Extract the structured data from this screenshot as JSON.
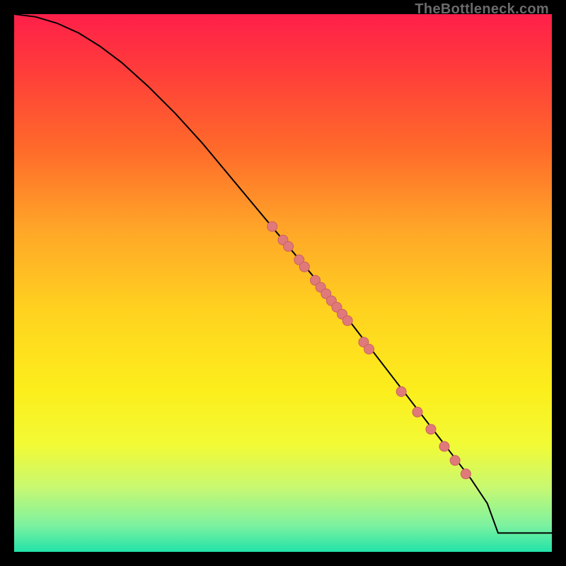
{
  "watermark": "TheBottleneck.com",
  "colors": {
    "line": "#000000",
    "dot_fill": "#e07a7a",
    "dot_stroke": "#c96060"
  },
  "chart_data": {
    "type": "line",
    "title": "",
    "xlabel": "",
    "ylabel": "",
    "xlim": [
      0,
      100
    ],
    "ylim": [
      0,
      100
    ],
    "series": [
      {
        "name": "curve",
        "x": [
          0,
          4,
          8,
          12,
          16,
          20,
          25,
          30,
          35,
          40,
          45,
          50,
          55,
          60,
          65,
          70,
          75,
          80,
          85,
          88,
          90,
          100
        ],
        "y": [
          100,
          99.5,
          98.3,
          96.5,
          94,
          91,
          86.5,
          81.5,
          76,
          70,
          64,
          58,
          52,
          46,
          39.5,
          33,
          26.5,
          20,
          13.5,
          9,
          3.5,
          3.5
        ]
      }
    ],
    "dots": {
      "name": "marked-points",
      "x": [
        48,
        50,
        51,
        53,
        54,
        56,
        57,
        58,
        59,
        60,
        61,
        62,
        65,
        66,
        72,
        75,
        77.5,
        80,
        82,
        84
      ],
      "y": [
        60.5,
        58,
        56.8,
        54.3,
        53,
        50.5,
        49.2,
        48,
        46.7,
        45.5,
        44.2,
        43,
        39,
        37.7,
        29.8,
        26,
        22.8,
        19.6,
        17,
        14.5
      ],
      "r": 7
    }
  }
}
